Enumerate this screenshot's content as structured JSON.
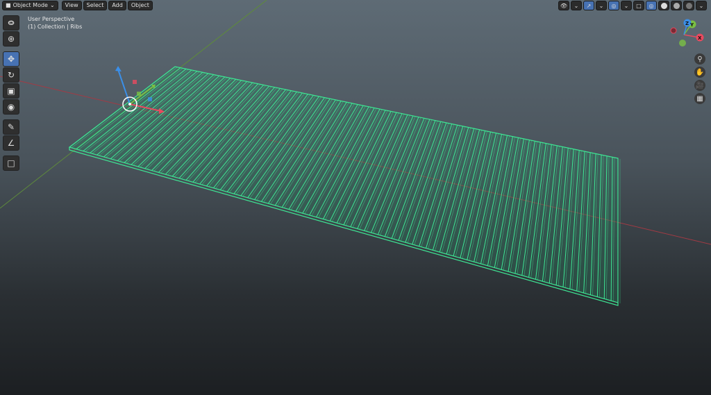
{
  "header": {
    "mode_label": "Object Mode",
    "menus": [
      "View",
      "Select",
      "Add",
      "Object"
    ]
  },
  "viewport_info": {
    "perspective": "User Perspective",
    "collection": "(1) Collection | Ribs"
  },
  "toolbar": {
    "tools": [
      "select-box",
      "cursor",
      "move",
      "rotate",
      "scale",
      "transform",
      "annotate",
      "measure",
      "add-cube"
    ],
    "active_tool": "move"
  },
  "nav_gizmo": {
    "axis_x": "X",
    "axis_y": "Y",
    "axis_z": "Z",
    "colors": {
      "x": "#e84a5f",
      "y": "#7ac043",
      "z": "#3b8fe8"
    }
  },
  "object": {
    "name": "Ribs",
    "rib_count": 80,
    "outline_color": "#3ee694",
    "fill_color": "#2a7d5f"
  },
  "axis_lines": {
    "x_color": "#a33a44",
    "y_color": "#5e8a3c"
  }
}
